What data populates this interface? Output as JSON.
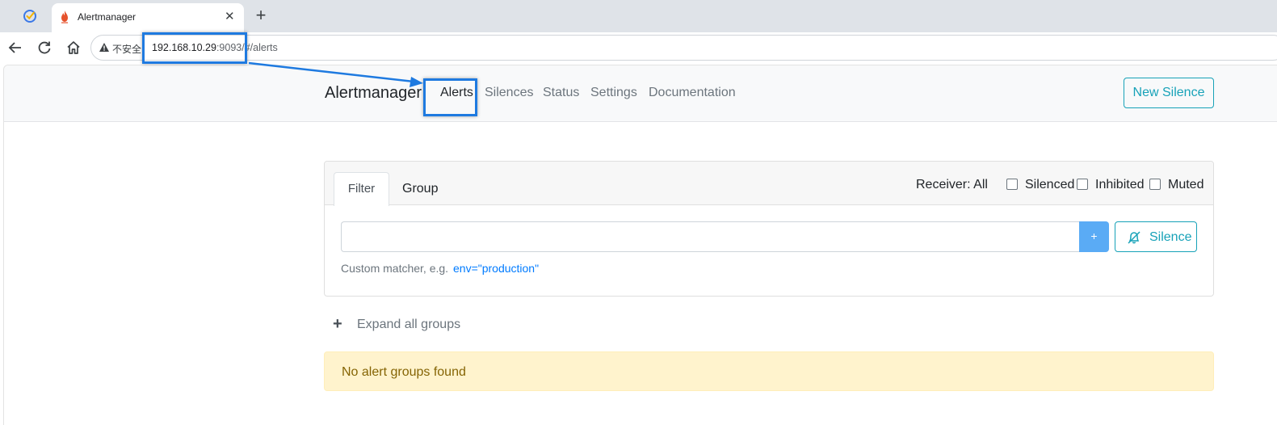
{
  "browser": {
    "tab_title": "Alertmanager",
    "close_glyph": "✕",
    "new_tab_glyph": "+",
    "security_label": "不安全",
    "url_host": "192.168.10.29",
    "url_port": ":9093",
    "url_path": "/#/alerts"
  },
  "navbar": {
    "brand": "Alertmanager",
    "links": [
      "Alerts",
      "Silences",
      "Status",
      "Settings",
      "Documentation"
    ],
    "active_link": "Alerts",
    "new_silence": "New Silence"
  },
  "filter_card": {
    "tabs": [
      "Filter",
      "Group"
    ],
    "active_tab": "Filter",
    "receiver": "Receiver: All",
    "checkboxes": [
      "Silenced",
      "Inhibited",
      "Muted"
    ],
    "matcher_value": "",
    "plus_label": "+",
    "silence_button": "Silence",
    "help_text": "Custom matcher, e.g.",
    "help_example": "env=\"production\""
  },
  "groups": {
    "expand_icon": "+",
    "expand_label": "Expand all groups",
    "empty_message": "No alert groups found"
  },
  "icons": {
    "pinned_tab": "circle-check-icon",
    "favicon": "alertmanager-flame-icon",
    "back": "back-arrow-icon",
    "reload": "reload-icon",
    "home": "home-icon",
    "warning": "warning-triangle-icon",
    "silence": "bell-slash-icon"
  },
  "colors": {
    "accent_info": "#17a2b8",
    "plus_button": "#5aabf5",
    "alert_background": "#fff3cd",
    "alert_text": "#856404",
    "annotation": "#1e7ae0"
  }
}
